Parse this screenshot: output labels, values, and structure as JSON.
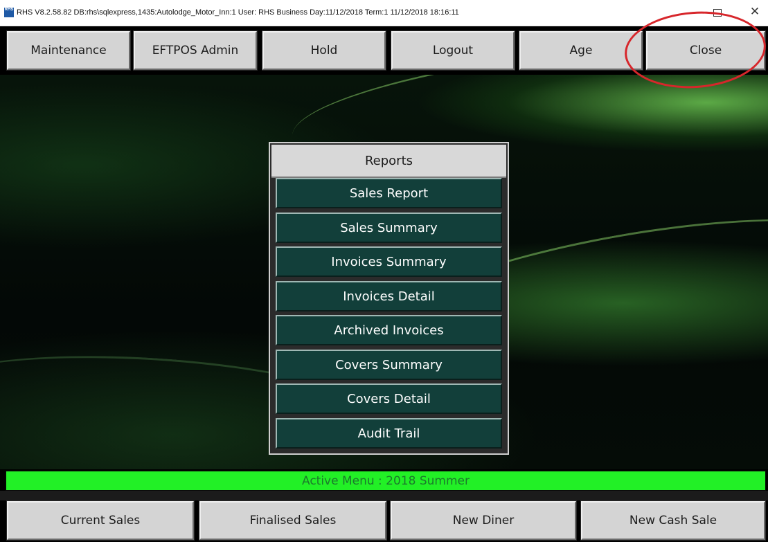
{
  "window": {
    "title": "RHS V8.2.58.82   DB:rhs\\sqlexpress,1435:Autolodge_Motor_Inn:1    User: RHS     Business Day:11/12/2018  Term:1   11/12/2018 18:16:11",
    "icon_text": "RHS",
    "close_glyph": "✕"
  },
  "toolbar": {
    "maintenance": "Maintenance",
    "eftpos_admin": "EFTPOS Admin",
    "hold": "Hold",
    "logout": "Logout",
    "age": "Age",
    "close": "Close"
  },
  "reports": {
    "title": "Reports",
    "items": [
      "Sales Report",
      "Sales Summary",
      "Invoices Summary",
      "Invoices Detail",
      "Archived Invoices",
      "Covers Summary",
      "Covers Detail",
      "Audit Trail"
    ]
  },
  "status": {
    "active_menu": "Active Menu : 2018 Summer"
  },
  "bottom": {
    "current_sales": "Current Sales",
    "finalised_sales": "Finalised Sales",
    "new_diner": "New Diner",
    "new_cash_sale": "New Cash Sale"
  },
  "colors": {
    "report_button": "#123f3a",
    "active_bar": "#22f026",
    "annotation": "#d7262b"
  }
}
